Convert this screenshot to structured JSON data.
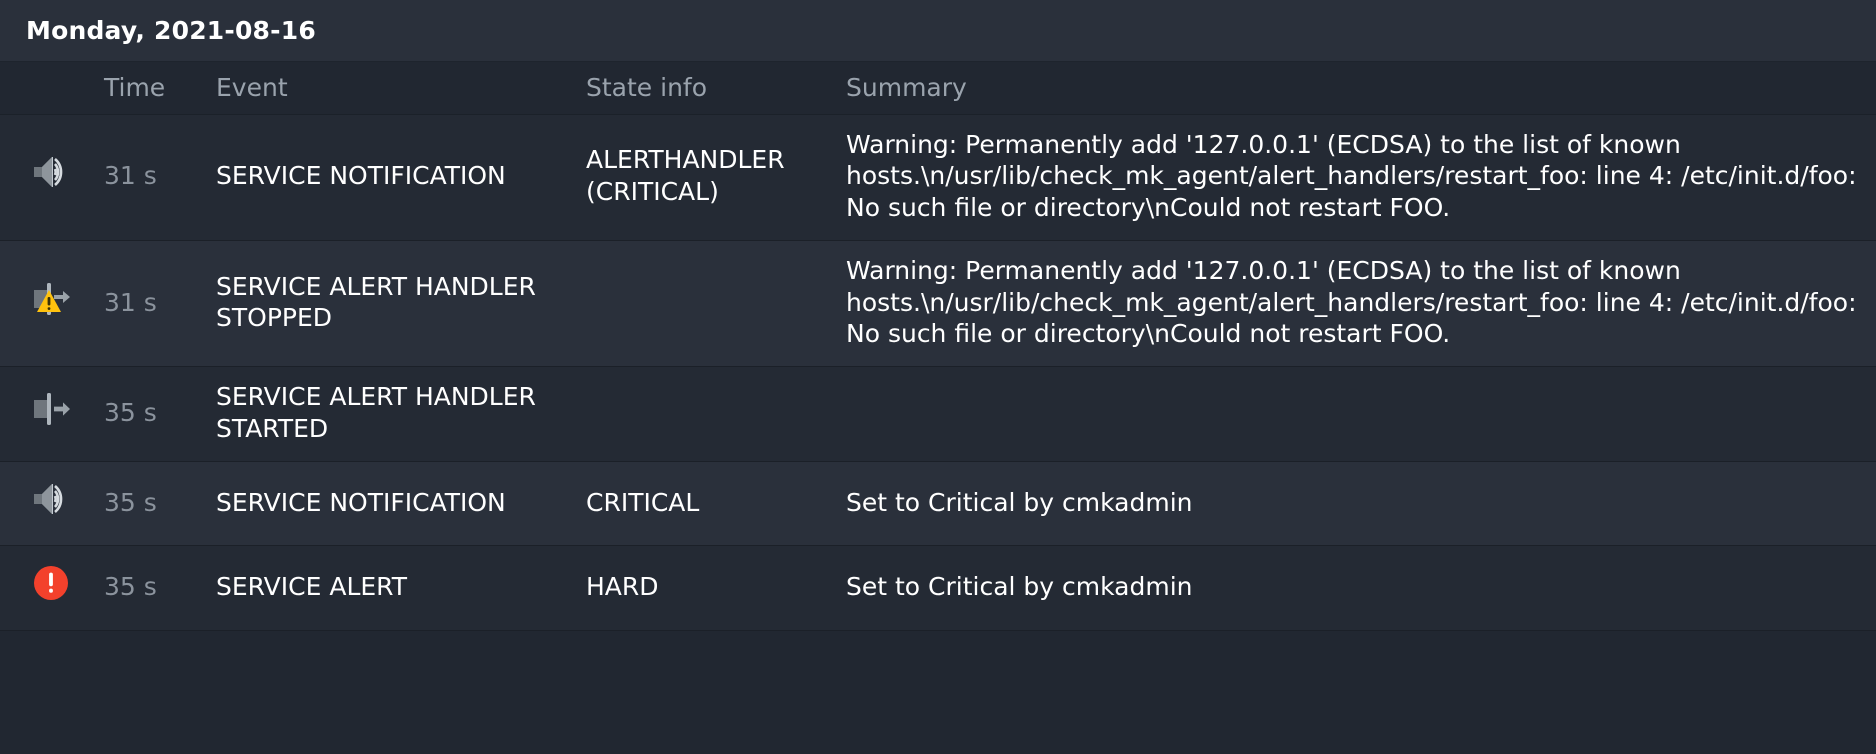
{
  "header": {
    "date_label": "Monday, 2021-08-16"
  },
  "colors": {
    "page_bg": "#212731",
    "header_bg": "#2a303b",
    "row_odd_bg": "#242a34",
    "row_even_bg": "#2a303b",
    "header_text": "#ffffff",
    "column_header_text": "#9aa3ad",
    "time_text": "#8b939d",
    "body_text": "#ffffff",
    "icon_gray": "#8e959c",
    "icon_gray_dark": "#6f767d",
    "warning_yellow": "#ffc20e",
    "critical_red": "#f3412c"
  },
  "table": {
    "columns": [
      {
        "key": "icon",
        "label": ""
      },
      {
        "key": "time",
        "label": "Time"
      },
      {
        "key": "event",
        "label": "Event"
      },
      {
        "key": "state",
        "label": "State info"
      },
      {
        "key": "summary",
        "label": "Summary"
      }
    ],
    "rows": [
      {
        "icon": "speaker-notification-icon",
        "time": "31 s",
        "event": "SERVICE NOTIFICATION",
        "state": "ALERTHANDLER (CRITICAL)",
        "summary": "Warning: Permanently add '127.0.0.1' (ECDSA) to the list of known hosts.\\n/usr/lib/check_mk_agent/alert_handlers/restart_foo: line 4: /etc/init.d/foo: No such file or directory\\nCould not restart FOO."
      },
      {
        "icon": "alert-handler-stopped-icon",
        "time": "31 s",
        "event": "SERVICE ALERT HANDLER STOPPED",
        "state": "",
        "summary": "Warning: Permanently add '127.0.0.1' (ECDSA) to the list of known hosts.\\n/usr/lib/check_mk_agent/alert_handlers/restart_foo: line 4: /etc/init.d/foo: No such file or directory\\nCould not restart FOO."
      },
      {
        "icon": "alert-handler-started-icon",
        "time": "35 s",
        "event": "SERVICE ALERT HANDLER STARTED",
        "state": "",
        "summary": ""
      },
      {
        "icon": "speaker-notification-icon",
        "time": "35 s",
        "event": "SERVICE NOTIFICATION",
        "state": "CRITICAL",
        "summary": "Set to Critical by cmkadmin"
      },
      {
        "icon": "critical-alert-icon",
        "time": "35 s",
        "event": "SERVICE ALERT",
        "state": "HARD",
        "summary": "Set to Critical by cmkadmin"
      }
    ]
  }
}
